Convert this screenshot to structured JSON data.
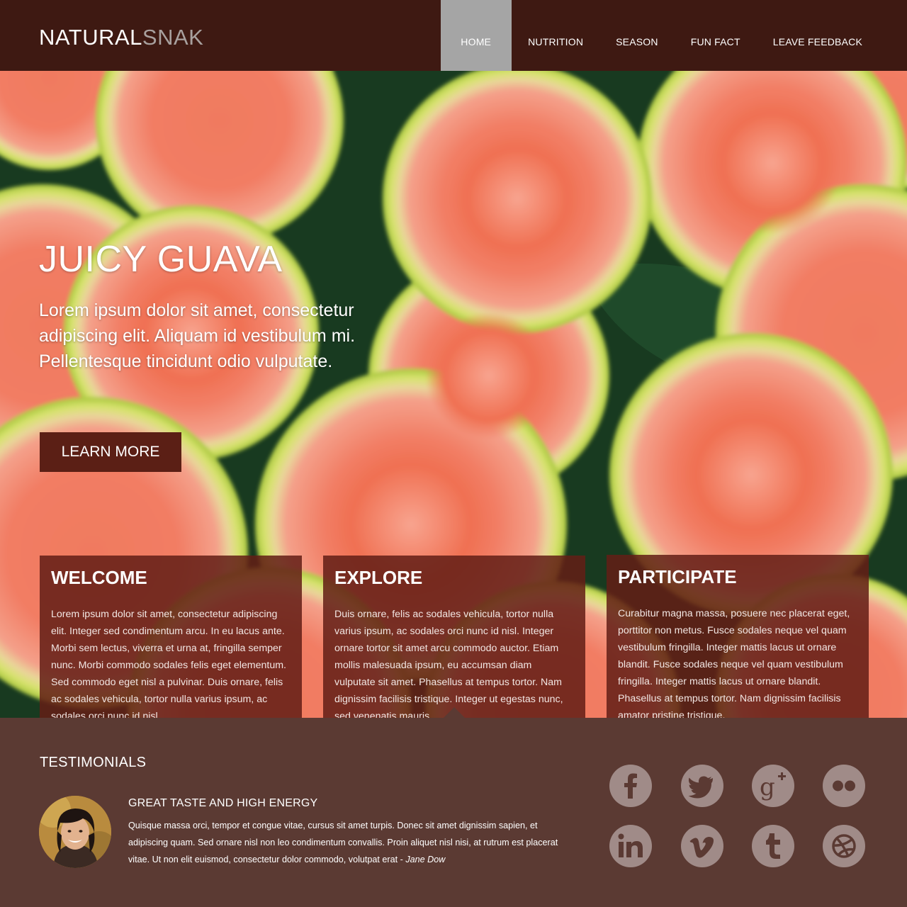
{
  "brand": {
    "logo_part1": "NATURAL",
    "logo_part2": "SNAK"
  },
  "nav": {
    "items": [
      {
        "label": "HOME",
        "active": true
      },
      {
        "label": "NUTRITION",
        "active": false
      },
      {
        "label": "SEASON",
        "active": false
      },
      {
        "label": "FUN FACT",
        "active": false
      },
      {
        "label": "LEAVE FEEDBACK",
        "active": false
      }
    ]
  },
  "hero": {
    "title": "JUICY GUAVA",
    "text": "Lorem ipsum dolor sit amet, consectetur adipiscing elit. Aliquam id vestibulum mi. Pellentesque tincidunt odio vulputate.",
    "button_label": "LEARN MORE"
  },
  "cards": [
    {
      "title": "WELCOME",
      "text": "Lorem ipsum dolor sit amet, consectetur adipiscing elit. Integer sed condimentum arcu. In eu lacus ante. Morbi sem lectus, viverra et urna at, fringilla semper nunc. Morbi commodo sodales felis eget elementum. Sed commodo eget nisl a pulvinar. Duis ornare, felis ac sodales vehicula, tortor nulla varius ipsum, ac sodales orci nunc id nisl."
    },
    {
      "title": "EXPLORE",
      "text": "Duis ornare, felis ac sodales vehicula, tortor nulla varius ipsum, ac sodales orci nunc id nisl. Integer ornare tortor sit amet arcu commodo auctor. Etiam mollis malesuada ipsum, eu accumsan diam vulputate sit amet. Phasellus at tempus tortor. Nam dignissim facilisis tristique. Integer ut egestas nunc, sed venenatis mauris."
    },
    {
      "title": "PARTICIPATE",
      "text": "Curabitur magna massa, posuere nec placerat eget, porttitor non metus. Fusce sodales neque vel quam vestibulum fringilla. Integer mattis lacus ut ornare blandit. Fusce sodales neque vel quam vestibulum fringilla. Integer mattis lacus ut ornare blandit. Phasellus at tempus tortor. Nam dignissim facilisis amator pristine tristique."
    }
  ],
  "testimonials": {
    "section_title": "TESTIMONIALS",
    "quote_title": "GREAT TASTE AND HIGH ENERGY",
    "quote_text": "Quisque massa orci, tempor et congue vitae, cursus sit amet turpis. Donec sit amet dignissim sapien, et adipiscing quam. Sed ornare nisl non leo condimentum convallis. Proin aliquet nisl nisi, at rutrum est placerat vitae. Ut non elit euismod, consectetur dolor commodo, volutpat erat - ",
    "author": "Jane Dow"
  },
  "social_icons": [
    "facebook-icon",
    "twitter-icon",
    "google-plus-icon",
    "flickr-icon",
    "linkedin-icon",
    "vimeo-icon",
    "tumblr-icon",
    "dribbble-icon"
  ],
  "colors": {
    "header_bg": "#3e1912",
    "nav_active_bg": "#a5a5a5",
    "button_bg": "#5b1f15",
    "card_bg": "#631e16",
    "footer_bg": "#5b3a33",
    "social_icon_bg": "#a08b88",
    "logo_accent": "#a8a09e"
  }
}
